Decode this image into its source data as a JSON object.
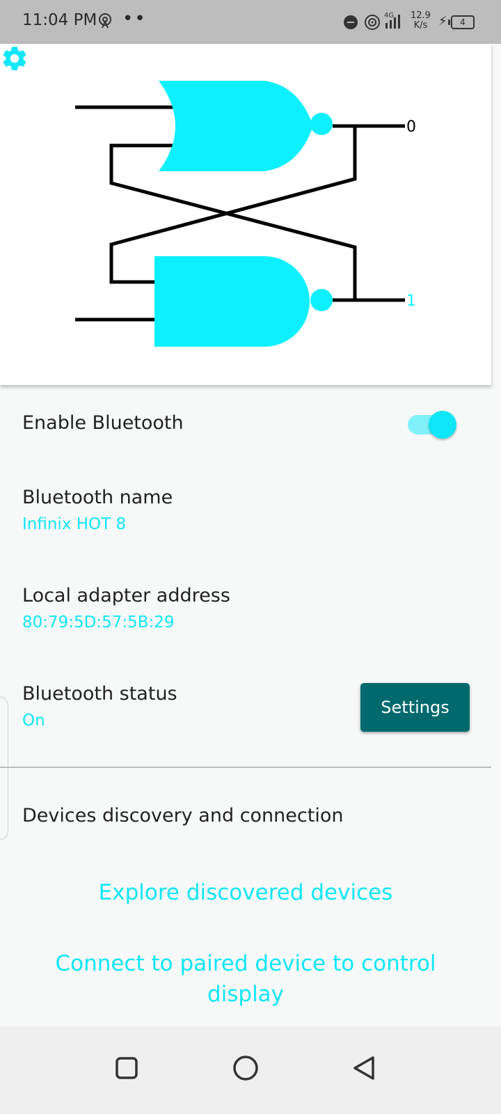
{
  "status_bar": {
    "time": "11:04 PM",
    "dots": "••",
    "network_type": "4G",
    "speed_value": "12.9",
    "speed_unit": "K/s",
    "battery_level": "4",
    "icons": [
      "hotspot-icon",
      "dnd-icon",
      "wifi-icon",
      "signal-icon",
      "charging-icon",
      "battery-icon"
    ]
  },
  "diagram": {
    "gate_color": "#0df0ff",
    "top_gate": "nor-gate-icon",
    "bottom_gate": "nand-gate-icon",
    "q_output": "0",
    "q_bar_output": "1",
    "settings_icon": "gear-icon"
  },
  "bluetooth": {
    "enable_label": "Enable Bluetooth",
    "enable_on": true,
    "name_label": "Bluetooth name",
    "name_value": "Infinix HOT 8",
    "address_label": "Local adapter address",
    "address_value": "80:79:5D:57:5B:29",
    "status_label": "Bluetooth status",
    "status_value": "On",
    "settings_button": "Settings"
  },
  "devices": {
    "section_title": "Devices discovery and connection",
    "explore_link": "Explore discovered devices",
    "connect_link_line1": "Connect to paired device to control",
    "connect_link_line2": "display"
  },
  "nav_bar": {
    "icons": [
      "recents-square-icon",
      "home-circle-icon",
      "back-triangle-icon"
    ]
  },
  "colors": {
    "accent": "#0fe6f7",
    "button": "#00696e",
    "status_bar": "#bdbdbd",
    "nav_bar": "#efefef"
  }
}
